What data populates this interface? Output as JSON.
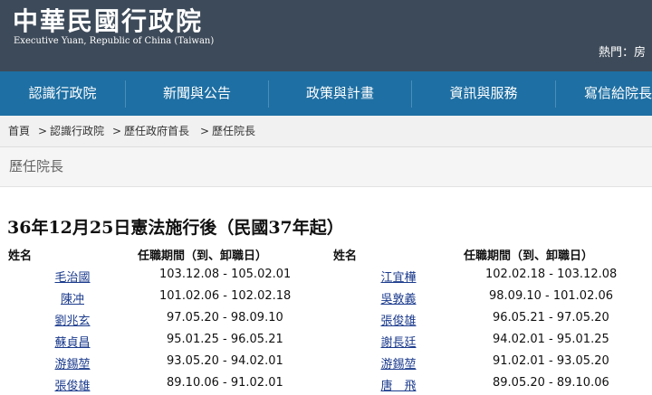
{
  "header": {
    "title": "中華民國行政院",
    "subtitle": "Executive Yuan, Republic of China (Taiwan)",
    "hot_label": "熱門：房"
  },
  "nav": [
    "認識行政院",
    "新聞與公告",
    "政策與計畫",
    "資訊與服務",
    "寫信給院長"
  ],
  "breadcrumb": [
    "首頁",
    "認識行政院",
    "歷任政府首長",
    "歷任院長"
  ],
  "breadcrumb_separator": ">",
  "page_title": "歷任院長",
  "section_title": "36年12月25日憲法施行後（民國37年起）",
  "columns": {
    "name": "姓名",
    "term": "任職期間（到、卸職日）"
  },
  "left": [
    {
      "name": "毛治國",
      "term": "103.12.08 - 105.02.01"
    },
    {
      "name": "陳冲",
      "term": "101.02.06 - 102.02.18"
    },
    {
      "name": "劉兆玄",
      "term": "97.05.20 - 98.09.10"
    },
    {
      "name": "蘇貞昌",
      "term": "95.01.25 - 96.05.21"
    },
    {
      "name": "游錫堃",
      "term": "93.05.20 - 94.02.01"
    },
    {
      "name": "張俊雄",
      "term": "89.10.06 - 91.02.01"
    }
  ],
  "right": [
    {
      "name": "江宜樺",
      "term": "102.02.18 - 103.12.08"
    },
    {
      "name": "吳敦義",
      "term": "98.09.10 - 101.02.06"
    },
    {
      "name": "張俊雄",
      "term": "96.05.21 - 97.05.20"
    },
    {
      "name": "謝長廷",
      "term": "94.02.01 - 95.01.25"
    },
    {
      "name": "游錫堃",
      "term": "91.02.01 - 93.05.20"
    },
    {
      "name": "唐　飛",
      "term": "89.05.20 - 89.10.06"
    }
  ]
}
